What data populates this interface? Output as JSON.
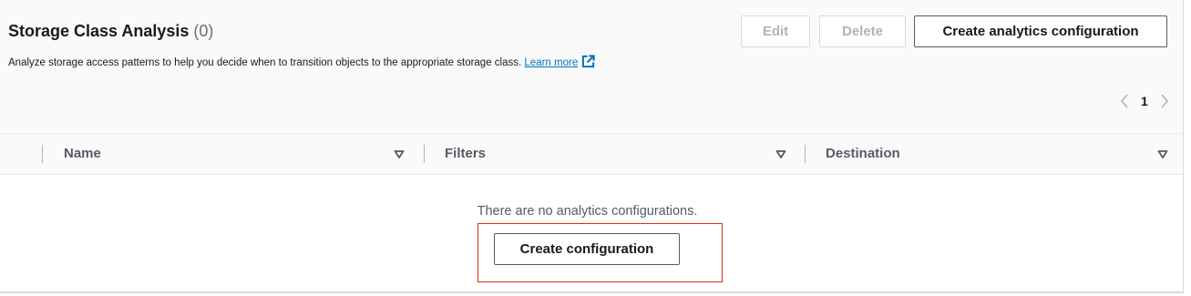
{
  "header": {
    "title": "Storage Class Analysis",
    "count": "(0)",
    "description": "Analyze storage access patterns to help you decide when to transition objects to the appropriate storage class.",
    "learn_more": "Learn more"
  },
  "toolbar": {
    "edit_label": "Edit",
    "delete_label": "Delete",
    "create_analytics_label": "Create analytics configuration"
  },
  "pagination": {
    "current_page": "1"
  },
  "table": {
    "columns": [
      "Name",
      "Filters",
      "Destination"
    ]
  },
  "empty_state": {
    "message": "There are no analytics configurations.",
    "button_label": "Create configuration"
  },
  "colors": {
    "link": "#0073bb",
    "highlight": "#d13212",
    "disabled": "#aab7b8"
  },
  "icons": [
    "external-link-icon",
    "chevron-left-icon",
    "chevron-right-icon",
    "sort-caret-icon"
  ]
}
